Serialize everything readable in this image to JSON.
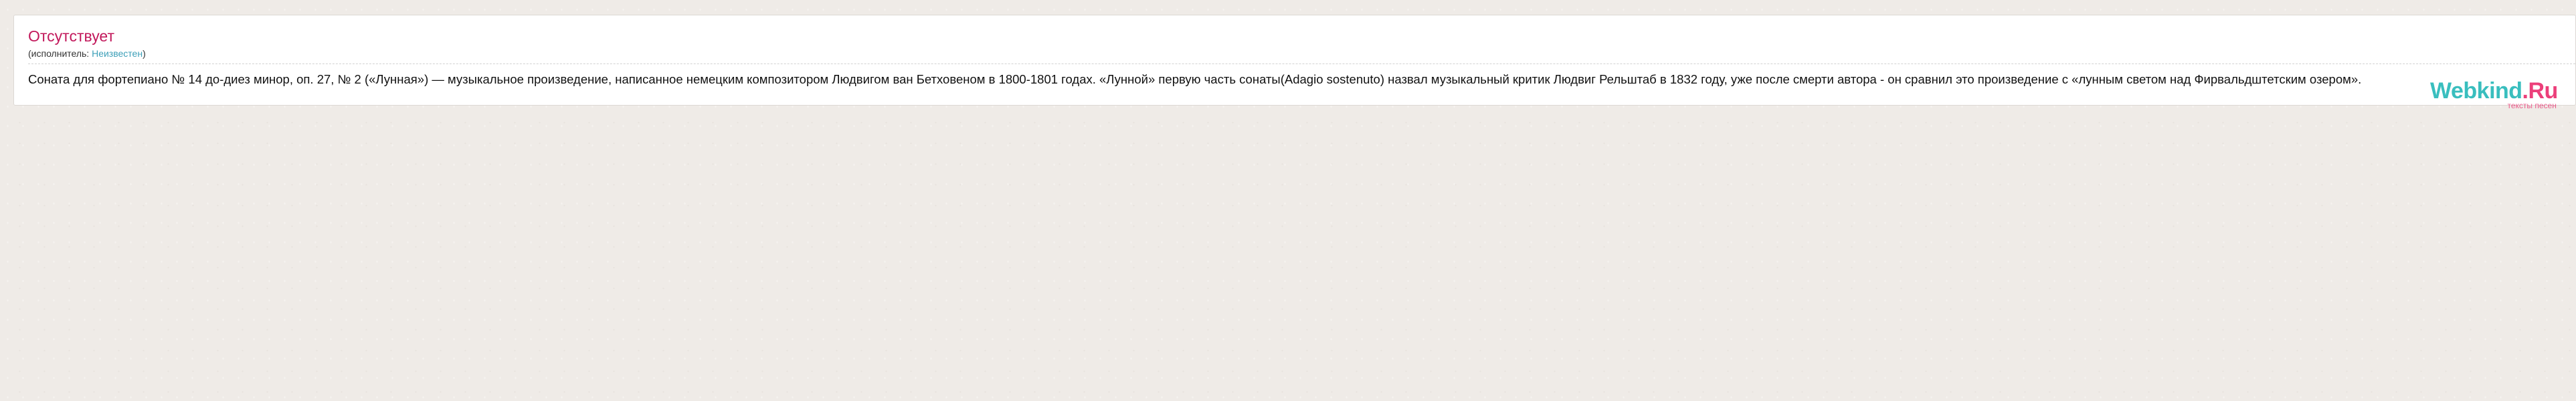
{
  "song": {
    "title": "Отсутствует",
    "performer_prefix": "(исполнитель: ",
    "performer_name": "Неизвестен",
    "performer_suffix": ")"
  },
  "description": "Соната для фортепиано № 14 до-диез минор, оп. 27, № 2 («Лунная») — музыкальное произведение, написанное немецким композитором Людвигом ван Бетховеном в 1800-1801 годах. «Лунной» первую часть сонаты(Adagio sostenuto) назвал музыкальный критик Людвиг Рельштаб в 1832 году, уже после смерти автора - он сравнил это произведение с «лунным светом над Фирвальдштетским озером».",
  "watermark": {
    "brand": "Webkind",
    "suffix": ".Ru",
    "tagline": "тексты песен"
  },
  "colors": {
    "background": "#efebe7",
    "title": "#c2185b",
    "link": "#3c9fb8",
    "watermark_brand": "#17b3b3",
    "watermark_accent": "#e91e63"
  }
}
